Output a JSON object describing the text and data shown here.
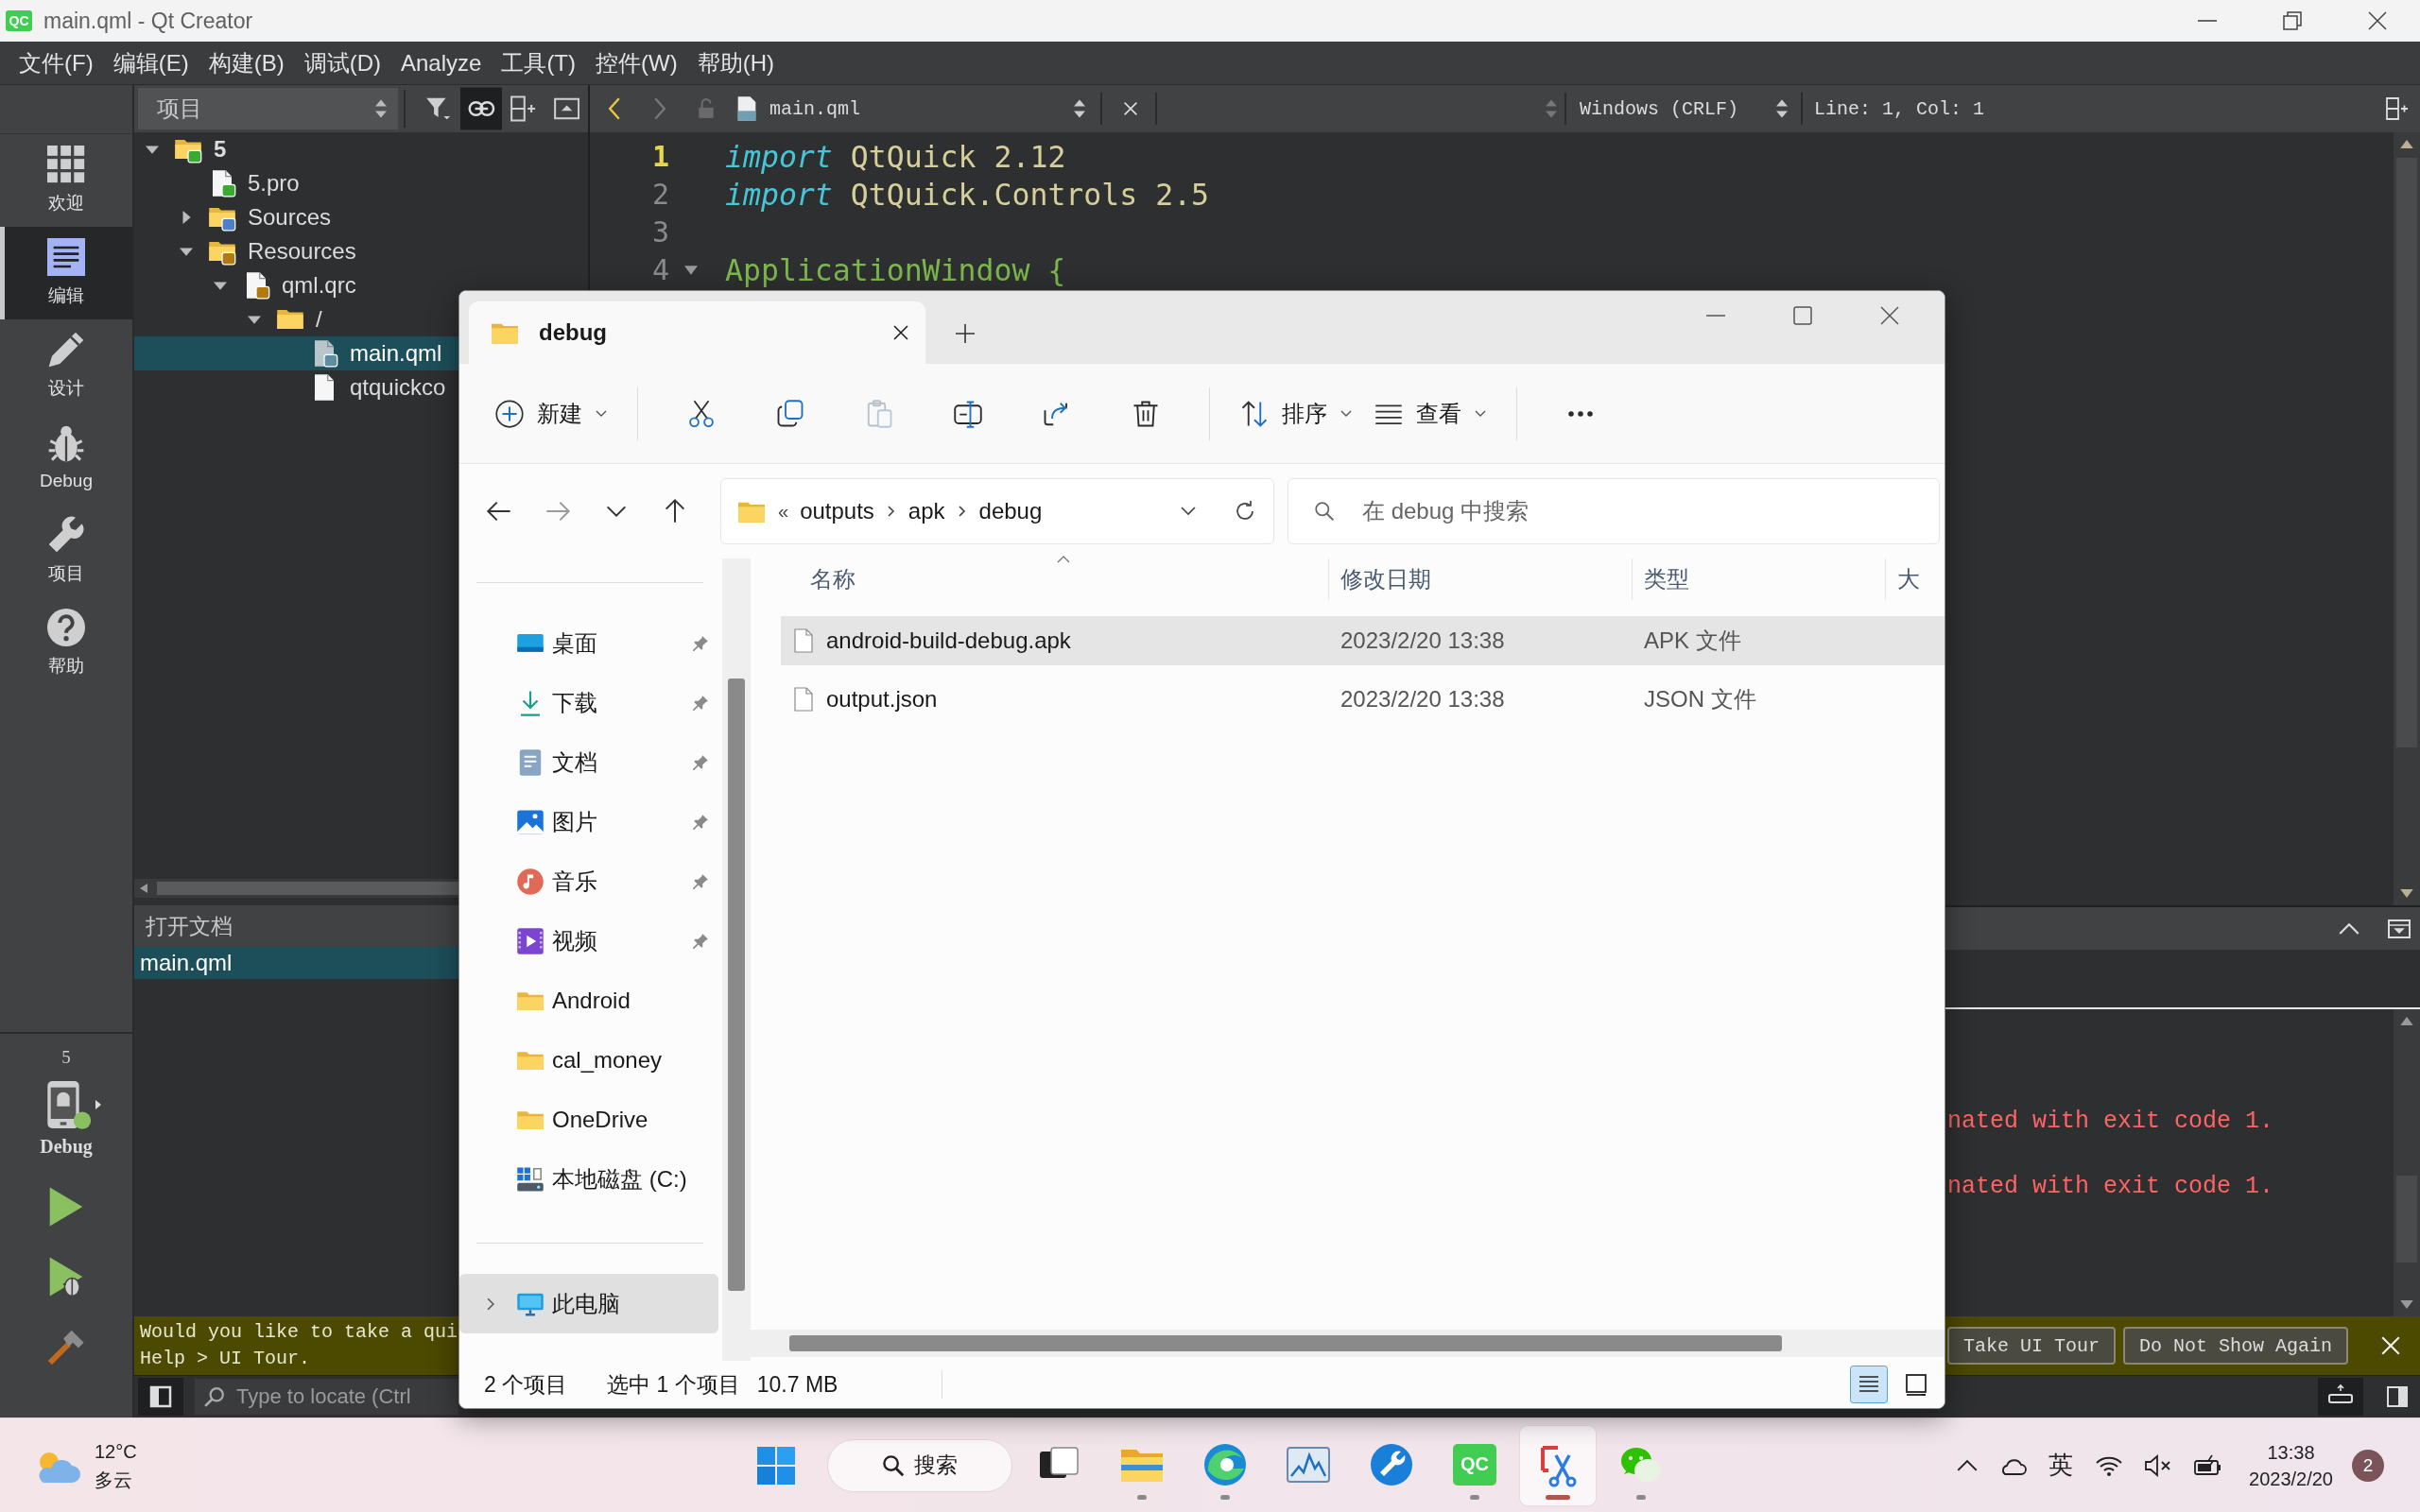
{
  "window": {
    "logo": "QC",
    "title": "main.qml - Qt Creator"
  },
  "menu": [
    "文件(F)",
    "编辑(E)",
    "构建(B)",
    "调试(D)",
    "Analyze",
    "工具(T)",
    "控件(W)",
    "帮助(H)"
  ],
  "modes": [
    {
      "label": "欢迎",
      "kind": "welcome",
      "selected": false
    },
    {
      "label": "编辑",
      "kind": "edit",
      "selected": true
    },
    {
      "label": "设计",
      "kind": "design",
      "selected": false
    },
    {
      "label": "Debug",
      "kind": "debug",
      "selected": false
    },
    {
      "label": "项目",
      "kind": "projects",
      "selected": false
    },
    {
      "label": "帮助",
      "kind": "help",
      "selected": false
    }
  ],
  "run_target": {
    "project": "5",
    "build": "Debug"
  },
  "project_panel": {
    "view": "项目",
    "sync_with_editor": true,
    "tree": [
      {
        "label": "5",
        "kind": "project",
        "expanded": true,
        "selected": false,
        "children": [
          {
            "label": "5.pro",
            "kind": "pro",
            "selected": false
          },
          {
            "label": "Sources",
            "kind": "sources",
            "expanded": false,
            "selected": false
          },
          {
            "label": "Resources",
            "kind": "resources",
            "expanded": true,
            "selected": false,
            "children": [
              {
                "label": "qml.qrc",
                "kind": "qrc",
                "expanded": true,
                "selected": false,
                "children": [
                  {
                    "label": "/",
                    "kind": "folder",
                    "expanded": true,
                    "selected": false,
                    "children": [
                      {
                        "label": "main.qml",
                        "kind": "qml",
                        "selected": true
                      },
                      {
                        "label": "qtquickco",
                        "kind": "file",
                        "selected": false
                      }
                    ]
                  }
                ]
              }
            ]
          }
        ]
      }
    ]
  },
  "open_documents": {
    "title": "打开文档",
    "items": [
      {
        "label": "main.qml",
        "selected": true
      }
    ]
  },
  "editor": {
    "file": "main.qml",
    "line_ending": "Windows (CRLF)",
    "cursor": "Line: 1, Col: 1",
    "lines": [
      {
        "number": "1",
        "current": true,
        "foldable": false,
        "tokens": [
          {
            "kind": "keyword",
            "text": "import"
          },
          {
            "kind": "plain",
            "text": "QtQuick 2.12"
          }
        ]
      },
      {
        "number": "2",
        "current": false,
        "foldable": false,
        "tokens": [
          {
            "kind": "keyword",
            "text": "import"
          },
          {
            "kind": "plain",
            "text": "QtQuick.Controls 2.5"
          }
        ]
      },
      {
        "number": "3",
        "current": false,
        "foldable": false
      },
      {
        "number": "4",
        "current": false,
        "foldable": true,
        "tokens": [
          {
            "kind": "type",
            "text": "ApplicationWindow {"
          }
        ]
      }
    ]
  },
  "output": {
    "lines": [
      "nated with exit code 1.",
      "nated with exit code 1."
    ]
  },
  "tour": {
    "lines": [
      "Would you like to take a qui",
      "Help > UI Tour."
    ],
    "buttons": [
      "Take UI Tour",
      "Do Not Show Again"
    ]
  },
  "locator": {
    "placeholder": "Type to locate (Ctrl"
  },
  "explorer": {
    "tabs": [
      {
        "label": "debug",
        "selected": true
      }
    ],
    "toolbar": [
      {
        "kind": "new",
        "label": "新建",
        "disabled": false
      },
      {
        "kind": "cut",
        "disabled": false
      },
      {
        "kind": "copy",
        "disabled": false
      },
      {
        "kind": "paste",
        "disabled": true
      },
      {
        "kind": "rename",
        "disabled": false
      },
      {
        "kind": "share",
        "disabled": false
      },
      {
        "kind": "delete",
        "disabled": false
      },
      {
        "kind": "sort",
        "label": "排序",
        "disabled": false
      },
      {
        "kind": "view",
        "label": "查看",
        "disabled": false
      },
      {
        "kind": "more",
        "disabled": false
      }
    ],
    "history": [
      {
        "kind": "back",
        "disabled": false
      },
      {
        "kind": "forward",
        "disabled": true
      },
      {
        "kind": "recent",
        "disabled": false
      },
      {
        "kind": "up",
        "disabled": false
      }
    ],
    "address": {
      "overflow": "«",
      "path": [
        "outputs",
        "apk",
        "debug"
      ]
    },
    "search": {
      "placeholder": "在 debug 中搜索"
    },
    "quick_access": [
      {
        "label": "桌面",
        "kind": "desktop",
        "pinned": true,
        "selected": false
      },
      {
        "label": "下载",
        "kind": "download",
        "pinned": true,
        "selected": false
      },
      {
        "label": "文档",
        "kind": "documents",
        "pinned": true,
        "selected": false
      },
      {
        "label": "图片",
        "kind": "pictures",
        "pinned": true,
        "selected": false
      },
      {
        "label": "音乐",
        "kind": "music",
        "pinned": true,
        "selected": false
      },
      {
        "label": "视频",
        "kind": "videos",
        "pinned": true,
        "selected": false
      },
      {
        "label": "Android",
        "kind": "folder",
        "pinned": false,
        "selected": false
      },
      {
        "label": "cal_money",
        "kind": "folder",
        "pinned": false,
        "selected": false
      },
      {
        "label": "OneDrive",
        "kind": "folder",
        "pinned": false,
        "selected": false
      },
      {
        "label": "本地磁盘 (C:)",
        "kind": "drive",
        "pinned": false,
        "selected": false
      }
    ],
    "locations": [
      {
        "label": "此电脑",
        "kind": "pc",
        "expanded": false,
        "selected": true
      }
    ],
    "columns": [
      {
        "label": "名称",
        "sorted": true
      },
      {
        "label": "修改日期",
        "sorted": false
      },
      {
        "label": "类型",
        "sorted": false
      },
      {
        "label": "大",
        "sorted": false
      }
    ],
    "files": [
      {
        "name": "android-build-debug.apk",
        "modified": "2023/2/20 13:38",
        "type": "APK 文件",
        "selected": true
      },
      {
        "name": "output.json",
        "modified": "2023/2/20 13:38",
        "type": "JSON 文件",
        "selected": false
      }
    ],
    "status": {
      "count": "2 个项目",
      "selection": "选中 1 个项目",
      "size": "10.7 MB"
    },
    "views": [
      {
        "kind": "details",
        "selected": true
      },
      {
        "kind": "tiles",
        "selected": false
      }
    ]
  },
  "taskbar": {
    "weather": {
      "temperature": "12°C",
      "condition": "多云"
    },
    "search": "搜索",
    "apps": [
      {
        "kind": "taskview",
        "running": false,
        "active": false
      },
      {
        "kind": "explorer",
        "running": true,
        "active": false
      },
      {
        "kind": "edge",
        "running": true,
        "active": false
      },
      {
        "kind": "monitor",
        "running": false,
        "active": false
      },
      {
        "kind": "wrench",
        "running": false,
        "active": false
      },
      {
        "kind": "qtcreator",
        "label": "QC",
        "running": true,
        "active": false
      },
      {
        "kind": "snip",
        "running": true,
        "active": true
      },
      {
        "kind": "wechat",
        "running": true,
        "active": false
      }
    ],
    "ime": "英",
    "time": "13:38",
    "date": "2023/2/20",
    "notifications": "2"
  }
}
